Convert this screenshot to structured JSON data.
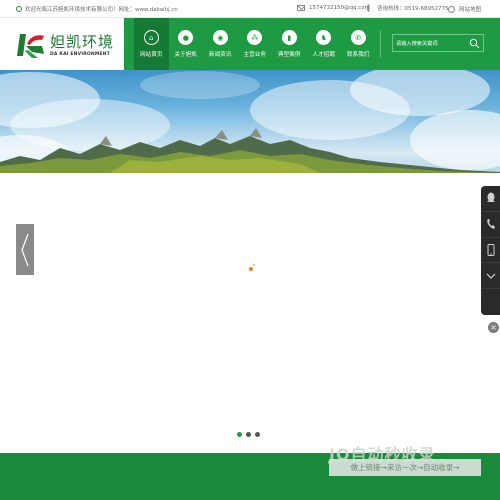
{
  "topbar": {
    "welcome_text": "欢迎光临江苏妲凯环境技术有限公司！网址：www.dakaihj.cn",
    "email": "1574732150@qq.com",
    "hotline": "咨询热线：0519-68952775",
    "sitemap_label": "网站地图"
  },
  "brand": {
    "name_cn": "妲凯环境",
    "name_en": "DA KAI ENVIRONMENT"
  },
  "nav": {
    "items": [
      {
        "label": "网站首页",
        "icon": "home-icon"
      },
      {
        "label": "关于妲凯",
        "icon": "about-icon"
      },
      {
        "label": "新闻资讯",
        "icon": "news-icon"
      },
      {
        "label": "主营业务",
        "icon": "business-icon"
      },
      {
        "label": "典型案例",
        "icon": "cases-icon"
      },
      {
        "label": "人才招聘",
        "icon": "recruit-icon"
      },
      {
        "label": "联系我们",
        "icon": "contact-icon"
      }
    ],
    "active_index": 0
  },
  "search": {
    "placeholder": "请输入搜索关键词"
  },
  "slider": {
    "dot_count": 3,
    "active_dot": 0
  },
  "watermark": {
    "title": "JQ自动秒收录",
    "subtitle": "做上链接→来访一次→自动收录→"
  },
  "colors": {
    "primary_green": "#1d9a42",
    "active_green": "#157a33",
    "footer_green": "#1a8a3c",
    "side_panel": "#2a2a2a"
  }
}
